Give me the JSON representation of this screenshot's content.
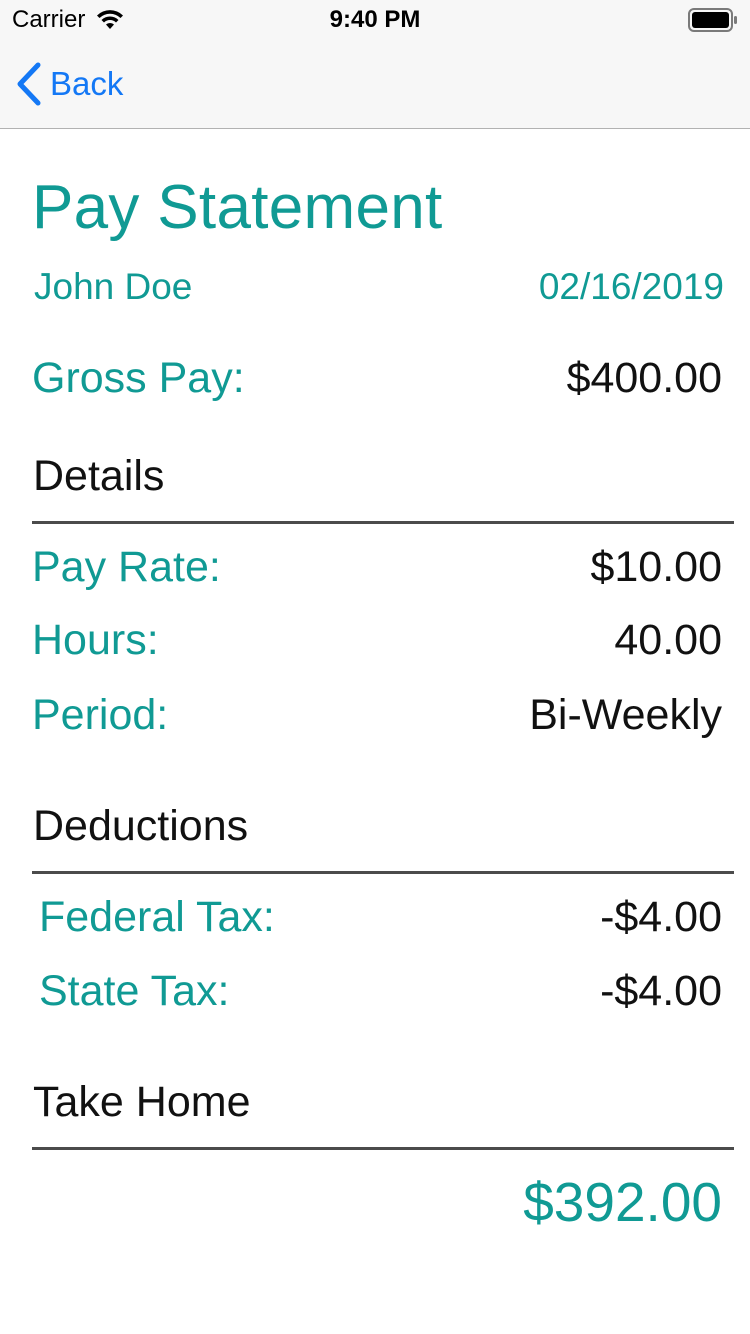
{
  "status_bar": {
    "carrier": "Carrier",
    "time": "9:40 PM",
    "wifi_icon": "wifi-icon",
    "battery_icon": "battery-icon"
  },
  "nav": {
    "back_label": "Back",
    "back_icon": "chevron-left-icon",
    "tint_color": "#1478f5"
  },
  "statement": {
    "title": "Pay Statement",
    "employee_name": "John Doe",
    "date": "02/16/2019",
    "gross_pay_label": "Gross Pay:",
    "gross_pay_value": "$400.00",
    "accent_color": "#109a94"
  },
  "details": {
    "title": "Details",
    "rows": [
      {
        "label": "Pay Rate:",
        "value": "$10.00"
      },
      {
        "label": "Hours:",
        "value": "40.00"
      },
      {
        "label": "Period:",
        "value": "Bi-Weekly"
      }
    ]
  },
  "deductions": {
    "title": "Deductions",
    "rows": [
      {
        "label": "Federal Tax:",
        "value": "-$4.00"
      },
      {
        "label": "State Tax:",
        "value": "-$4.00"
      }
    ]
  },
  "take_home": {
    "title": "Take Home",
    "amount": "$392.00"
  }
}
